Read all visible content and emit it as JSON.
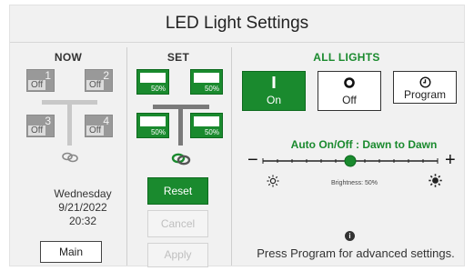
{
  "title": "LED Light Settings",
  "now": {
    "heading": "NOW",
    "lamps": [
      {
        "num": "1",
        "state": "Off"
      },
      {
        "num": "2",
        "state": "Off"
      },
      {
        "num": "3",
        "state": "Off"
      },
      {
        "num": "4",
        "state": "Off"
      }
    ],
    "link_icon": "chain-link-icon",
    "date": "Wednesday",
    "day": "9/21/2022",
    "time": "20:32",
    "main_label": "Main"
  },
  "set": {
    "heading": "SET",
    "lamps": [
      {
        "pct": "50%"
      },
      {
        "pct": "50%"
      },
      {
        "pct": "50%"
      },
      {
        "pct": "50%"
      }
    ],
    "link_icon": "chain-link-icon",
    "reset_label": "Reset",
    "cancel_label": "Cancel",
    "apply_label": "Apply"
  },
  "all": {
    "heading": "ALL LIGHTS",
    "modes": [
      {
        "label": "On",
        "active": true,
        "icon": "power-bar-icon"
      },
      {
        "label": "Off",
        "active": false,
        "icon": "power-ring-icon"
      },
      {
        "label": "Program",
        "active": false,
        "icon": "clock-icon"
      }
    ],
    "auto_text": "Auto On/Off : Dawn to Dawn",
    "minus": "−",
    "plus": "+",
    "brightness_label": "Brightness: 50%",
    "brightness_value": 0.5,
    "info_glyph": "i",
    "note": "Press Program for advanced settings.",
    "accent_color": "#1a8a2e"
  }
}
